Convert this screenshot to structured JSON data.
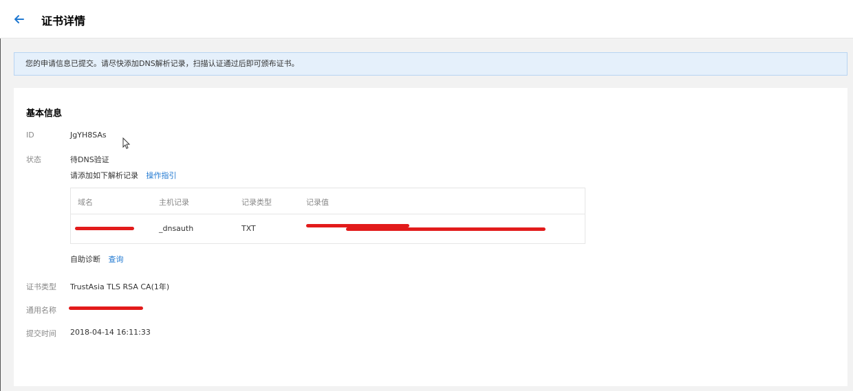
{
  "header": {
    "title": "证书详情"
  },
  "notice": {
    "text": "您的申请信息已提交。请尽快添加DNS解析记录，扫描认证通过后即可颁布证书。"
  },
  "basic_info": {
    "section_title": "基本信息",
    "id_label": "ID",
    "id_value": "JgYH8SAs",
    "status_label": "状态",
    "status_value": "待DNS验证",
    "add_record_hint": "请添加如下解析记录",
    "guide_link": "操作指引",
    "dns_table": {
      "columns": [
        "域名",
        "主机记录",
        "记录类型",
        "记录值"
      ],
      "row": {
        "domain": "",
        "host": "_dnsauth",
        "type": "TXT",
        "value": ""
      }
    },
    "self_diagnose_label": "自助诊断",
    "query_link": "查询",
    "cert_type_label": "证书类型",
    "cert_type_value": "TrustAsia TLS RSA CA(1年)",
    "common_name_label": "通用名称",
    "common_name_value": "",
    "submit_time_label": "提交时间",
    "submit_time_value": "2018-04-14 16:11:33"
  },
  "colors": {
    "accent": "#1f78d1",
    "redaction": "#e21b1b",
    "notice_bg": "#e5f0fb"
  },
  "icons": {
    "back": "arrow-left-icon",
    "cursor": "mouse-pointer-icon"
  }
}
